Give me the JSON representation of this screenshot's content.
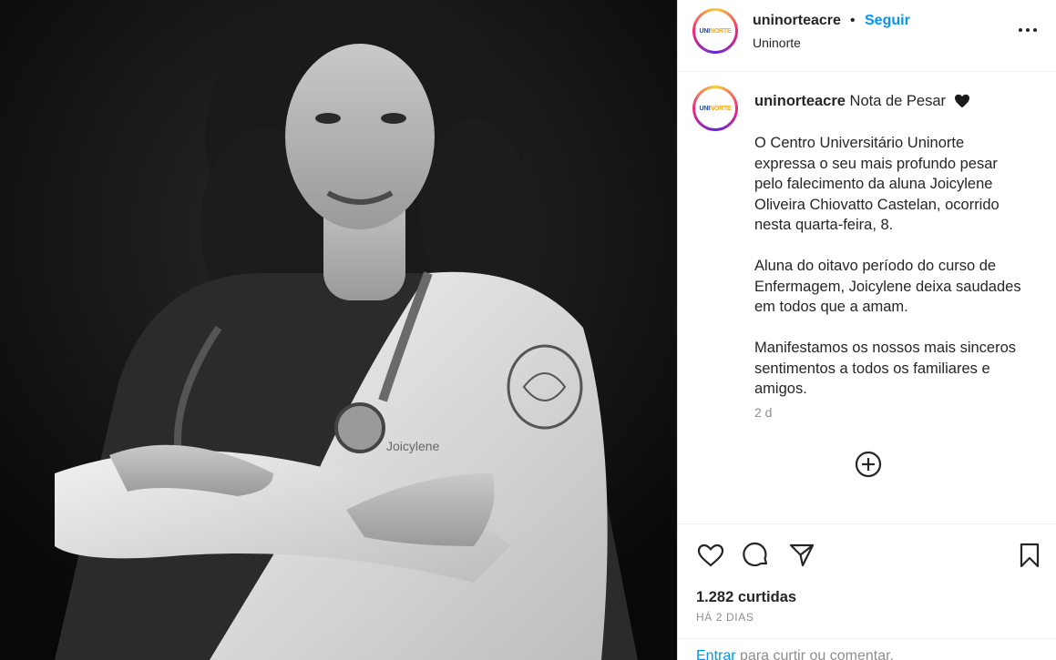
{
  "post": {
    "username": "uninorteacre",
    "dot": "•",
    "follow_label": "Seguir",
    "location": "Uninorte",
    "logo_text_main": "UNI",
    "logo_text_accent": "NORTE",
    "photo_name_tag": "Joicylene"
  },
  "caption": {
    "username": "uninorteacre",
    "title": "Nota de Pesar",
    "paragraphs": [
      "O Centro Universitário Uninorte expressa o seu mais profundo pesar pelo falecimento da aluna Joicylene Oliveira Chiovatto Castelan, ocorrido nesta quarta-feira, 8.",
      "Aluna do oitavo período do curso de Enfermagem, Joicylene deixa saudades em todos que a amam.",
      "Manifestamos os nossos mais sinceros sentimentos a todos os familiares e amigos."
    ],
    "time": "2 d"
  },
  "stats": {
    "likes": "1.282 curtidas",
    "ago": "HÁ 2 DIAS"
  },
  "login": {
    "link": "Entrar",
    "rest": " para curtir ou comentar."
  },
  "icons": {
    "heart_title": "heart-icon",
    "more": "more-options-icon",
    "add_comment": "add-comment-icon",
    "like": "like-icon",
    "comment": "comment-icon",
    "share": "share-icon",
    "save": "save-icon"
  },
  "colors": {
    "link": "#0095f6",
    "text": "#262626",
    "muted": "#8e8e8e",
    "divider": "#efefef"
  }
}
